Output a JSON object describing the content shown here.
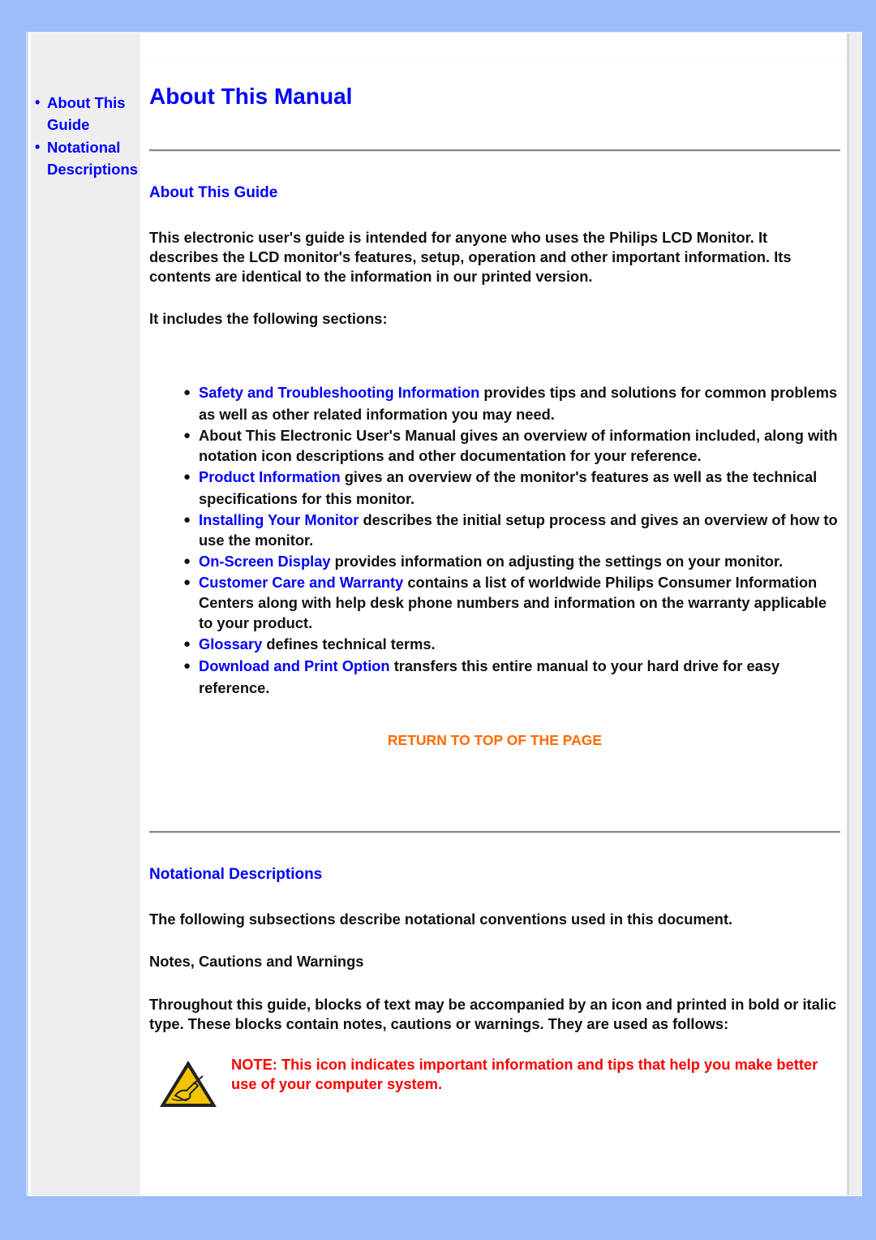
{
  "sidebar": {
    "items": [
      {
        "label": "About This Guide",
        "icon": "bullet"
      },
      {
        "label": "Notational Descriptions",
        "icon": "bullet"
      }
    ]
  },
  "page": {
    "title": "About This Manual"
  },
  "about_guide": {
    "heading": "About This Guide",
    "intro": "This electronic user's guide is intended for anyone who uses the Philips LCD Monitor. It describes the LCD monitor's features, setup, operation and other important information. Its contents are identical to the information in our printed version.",
    "includes": "It includes the following sections:",
    "sections": [
      {
        "link": "Safety and Troubleshooting Information",
        "text": " provides tips and solutions for common problems as well as other related information you may need."
      },
      {
        "link": "",
        "text": "About This Electronic User's Manual gives an overview of information included, along with notation icon descriptions and other documentation for your reference."
      },
      {
        "link": "Product Information",
        "text": " gives an overview of the monitor's features as well as the technical specifications for this monitor."
      },
      {
        "link": "Installing Your Monitor",
        "text": " describes the initial setup process and gives an overview of how to use the monitor."
      },
      {
        "link": "On-Screen Display",
        "text": " provides information on adjusting the settings on your monitor."
      },
      {
        "link": "Customer Care and Warranty",
        "text": " contains a list of worldwide Philips Consumer Information Centers along with help desk phone numbers and information on the warranty applicable to your product."
      },
      {
        "link": "Glossary",
        "text": " defines technical terms."
      },
      {
        "link": "Download and Print Option",
        "text": " transfers this entire manual to your hard drive for easy reference."
      }
    ],
    "bullet_glyph": "●"
  },
  "return_link": "RETURN TO TOP OF THE PAGE",
  "notational": {
    "heading": "Notational Descriptions",
    "intro": "The following subsections describe notational conventions used in this document.",
    "subheading": "Notes, Cautions and Warnings",
    "body": "Throughout this guide, blocks of text may be accompanied by an icon and printed in bold or italic type. These blocks contain notes, cautions or warnings. They are used as follows:",
    "note": {
      "icon": "note-pencil-warning-icon",
      "text": "NOTE: This icon indicates important information and tips that help you make better use of your computer system."
    }
  },
  "colors": {
    "background": "#9bbcf8",
    "link": "#0000ff",
    "return_link": "#ff6a00",
    "note_text": "#ff0000",
    "sidebar": "#eeeeee"
  }
}
